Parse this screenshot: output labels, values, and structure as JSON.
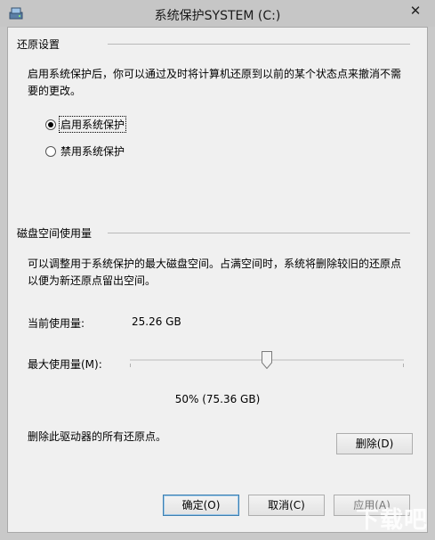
{
  "window": {
    "title": "系统保护SYSTEM (C:)",
    "close_glyph": "✕"
  },
  "restore_settings": {
    "group_title": "还原设置",
    "description_line1": "启用系统保护后，你可以通过及时将计算机还原到以前的某个状态点来撤消不需",
    "description_line2": "要的更改。",
    "options": [
      {
        "label": "启用系统保护",
        "selected": true
      },
      {
        "label": "禁用系统保护",
        "selected": false
      }
    ]
  },
  "disk_space": {
    "group_title": "磁盘空间使用量",
    "description_line1": "可以调整用于系统保护的最大磁盘空间。占满空间时，系统将删除较旧的还原点",
    "description_line2": "以便为新还原点留出空间。",
    "current_usage_label": "当前使用量:",
    "current_usage_value": "25.26 GB",
    "max_usage_label": "最大使用量(M):",
    "max_usage_percent": 50,
    "max_usage_display": "50% (75.36 GB)",
    "delete_description": "删除此驱动器的所有还原点。",
    "delete_button": "删除(D)"
  },
  "footer": {
    "ok_button": "确定(O)",
    "cancel_button": "取消(C)",
    "apply_button": "应用(A)"
  },
  "watermark": "下载吧"
}
